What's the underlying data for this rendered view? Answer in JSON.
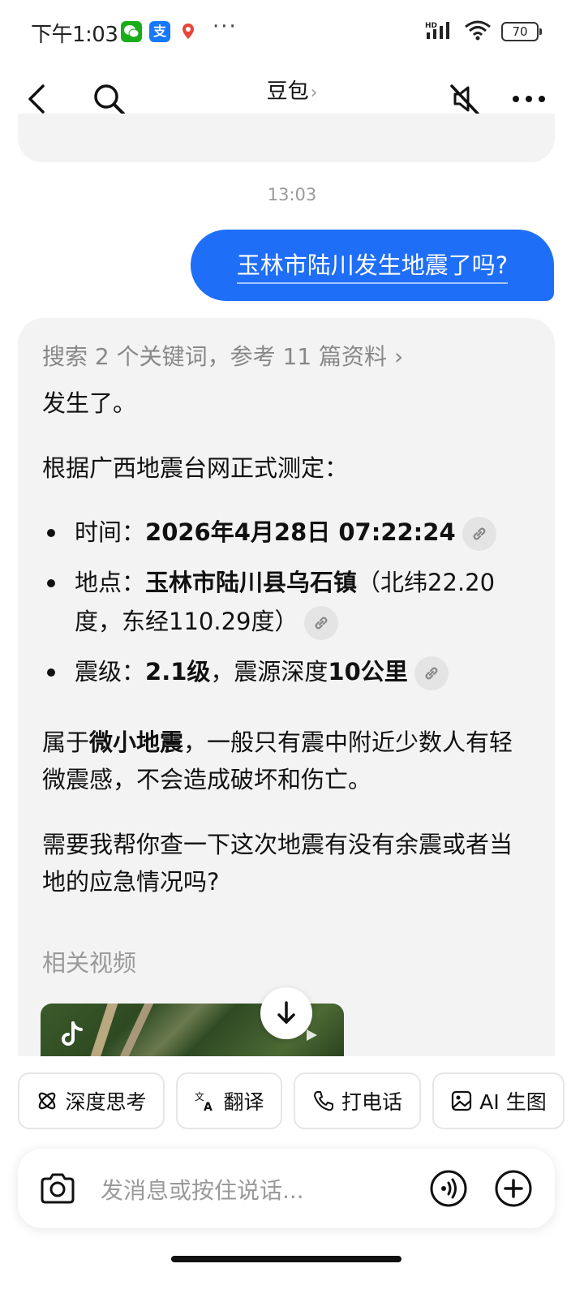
{
  "status_bar": {
    "time": "下午1:03",
    "apps": [
      "wechat-icon",
      "alipay-icon",
      "maps-icon"
    ],
    "more": "···",
    "network": "HD",
    "battery": "70"
  },
  "nav": {
    "title": "豆包",
    "title_chevron": "›"
  },
  "chat": {
    "timestamp": "13:03",
    "user_message": "玉林市陆川发生地震了吗?",
    "answer": {
      "search_ref": "搜索 2 个关键词，参考 11 篇资料 ›",
      "intro": "发生了。",
      "source_line": "根据广西地震台网正式测定：",
      "bullets": {
        "time_label": "时间：",
        "time_value": "2026年4月28日 07:22:24",
        "place_label": "地点：",
        "place_value": "玉林市陆川县乌石镇",
        "place_coords": "（北纬22.20度，东经110.29度）",
        "mag_label": "震级：",
        "mag_value": "2.1级",
        "mag_sep": "，震源深度",
        "depth_value": "10公里"
      },
      "desc_prefix": "属于",
      "desc_bold": "微小地震",
      "desc_rest": "，一般只有震中附近少数人有轻微震感，不会造成破坏和伤亡。",
      "followup": "需要我帮你查一下这次地震有没有余震或者当地的应急情况吗?",
      "related_label": "相关视频"
    }
  },
  "quick_actions": [
    {
      "label": "深度思考",
      "icon": "atom-icon"
    },
    {
      "label": "翻译",
      "icon": "translate-icon"
    },
    {
      "label": "打电话",
      "icon": "phone-icon"
    },
    {
      "label": "AI 生图",
      "icon": "image-icon"
    }
  ],
  "input": {
    "placeholder": "发消息或按住说话..."
  }
}
